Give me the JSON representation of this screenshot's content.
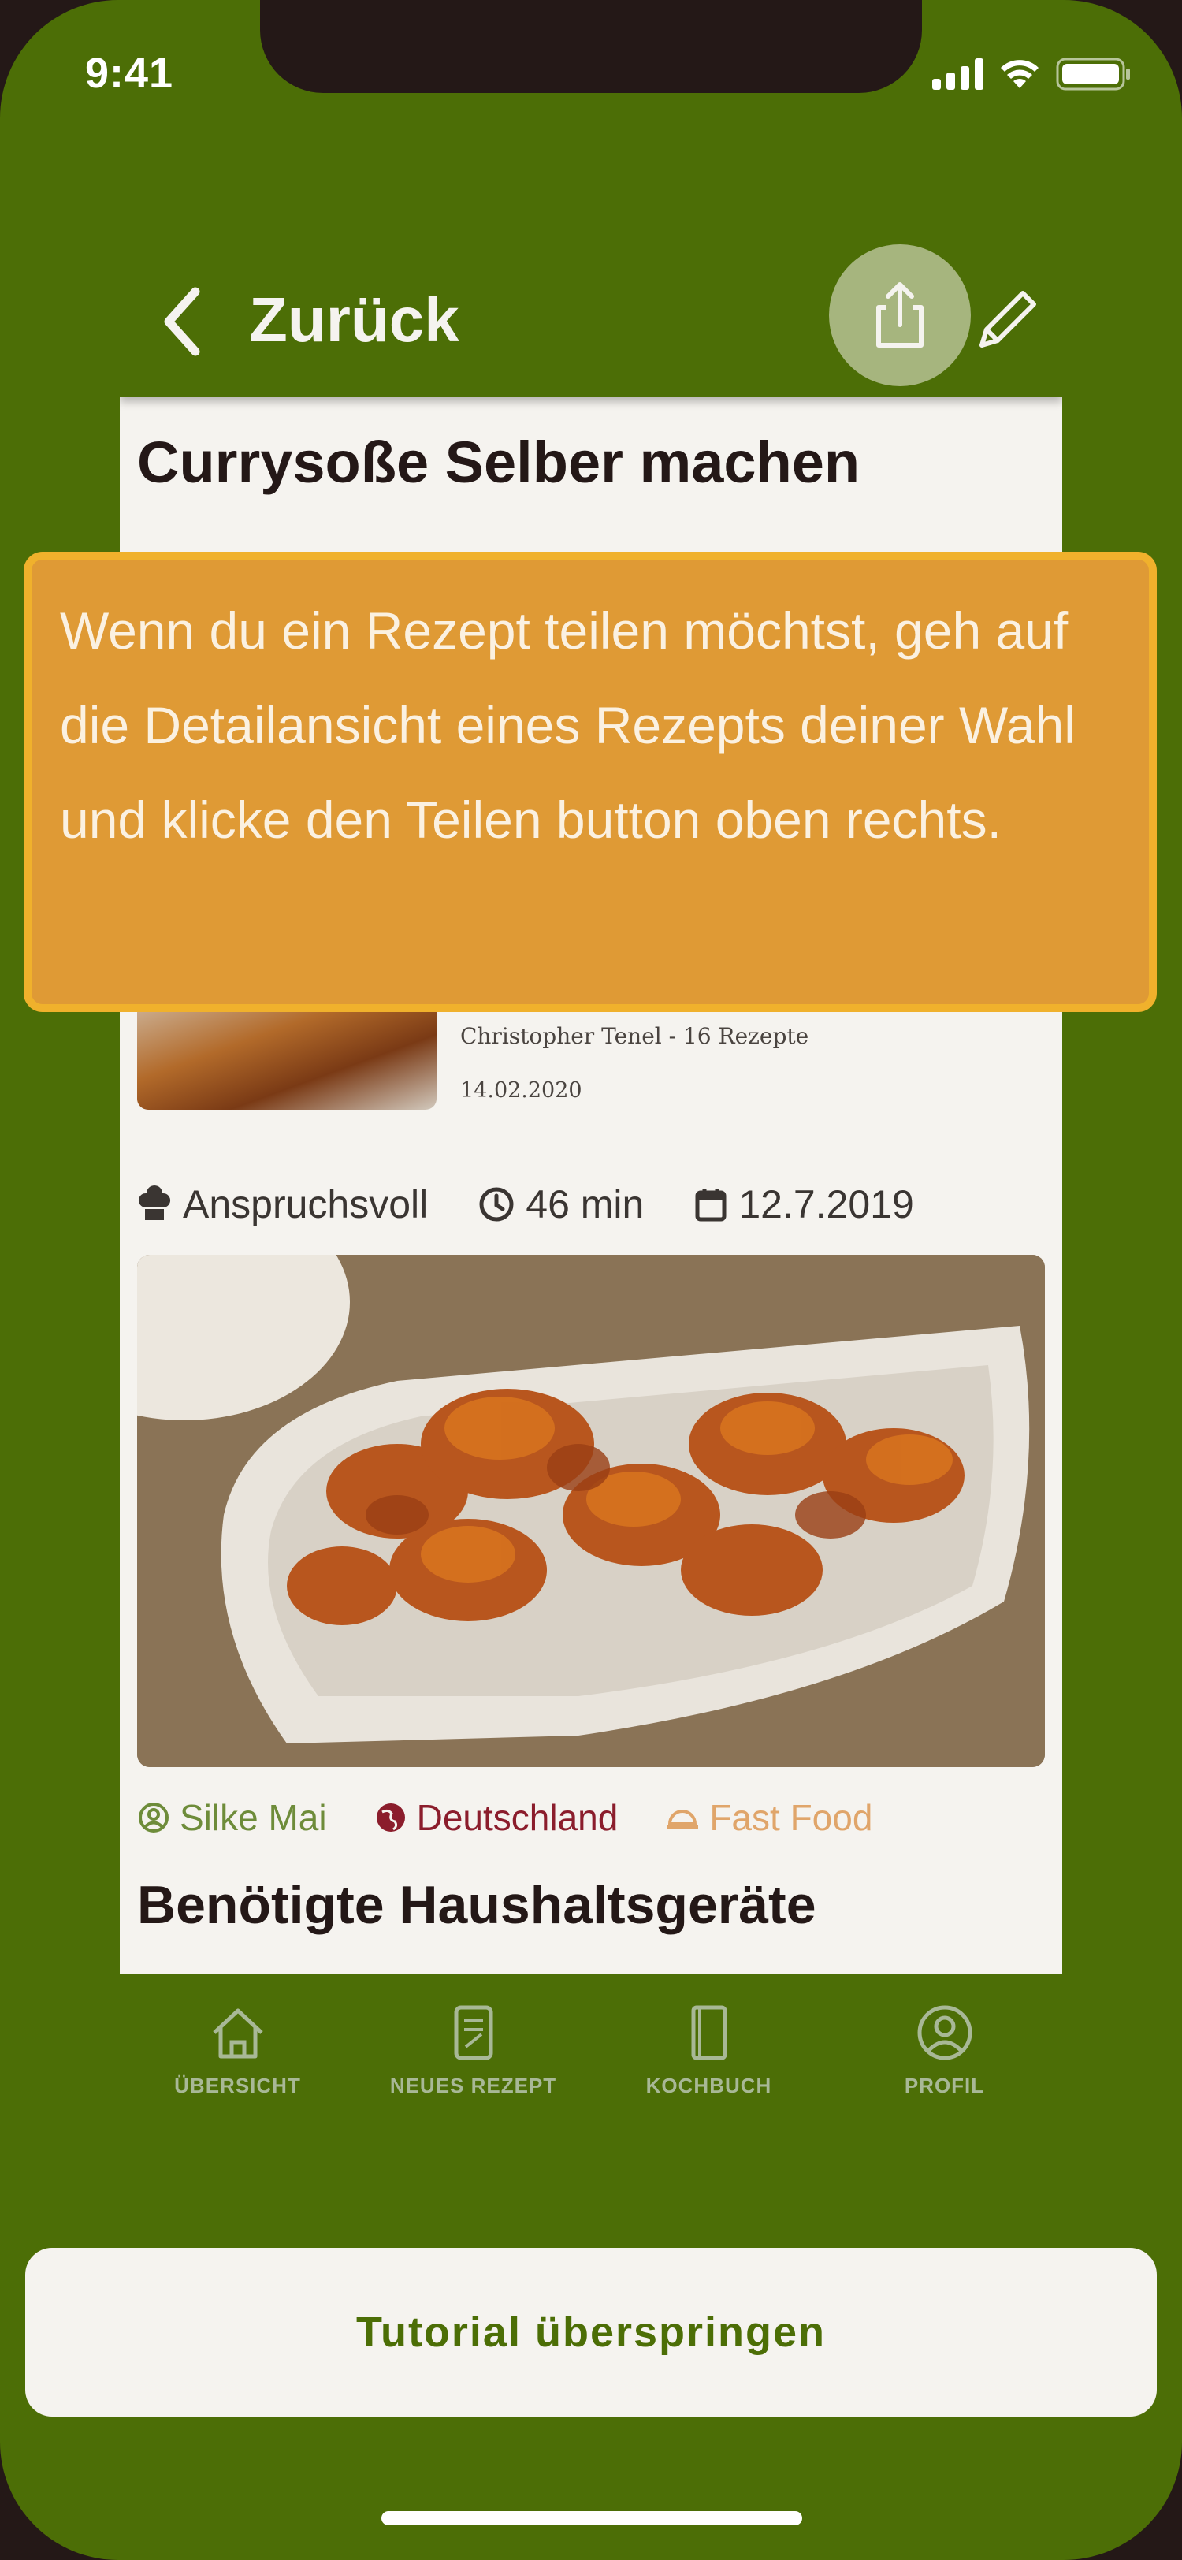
{
  "status_bar": {
    "time": "9:41"
  },
  "header": {
    "back_label": "Zurück"
  },
  "recipe": {
    "title": "Currysoße Selber machen",
    "author": "Christopher Tenel - 16 Rezepte",
    "date": "14.02.2020",
    "difficulty": "Anspruchsvoll",
    "duration": "46 min",
    "created": "12.7.2019",
    "tags": {
      "author_tag": "Silke Mai",
      "country": "Deutschland",
      "category": "Fast Food"
    },
    "section_title": "Benötigte Haushaltsgeräte"
  },
  "tabbar": {
    "items": [
      {
        "label": "ÜBERSICHT",
        "icon": "house-icon"
      },
      {
        "label": "NEUES REZEPT",
        "icon": "new-recipe-icon"
      },
      {
        "label": "KOCHBUCH",
        "icon": "cookbook-icon"
      },
      {
        "label": "PROFIL",
        "icon": "profile-icon"
      }
    ]
  },
  "tutorial": {
    "text": "Wenn du ein Rezept teilen möchtst, geh auf die Detailansicht eines Rezepts deiner Wahl und klicke den Teilen button oben rechts.",
    "skip_label": "Tutorial überspringen"
  },
  "colors": {
    "brand_green": "#4c6e06",
    "tooltip_fill": "#df9a35",
    "tooltip_border": "#f0b12c",
    "country_red": "#8b1d2c",
    "category_orange": "#e0a56a"
  }
}
